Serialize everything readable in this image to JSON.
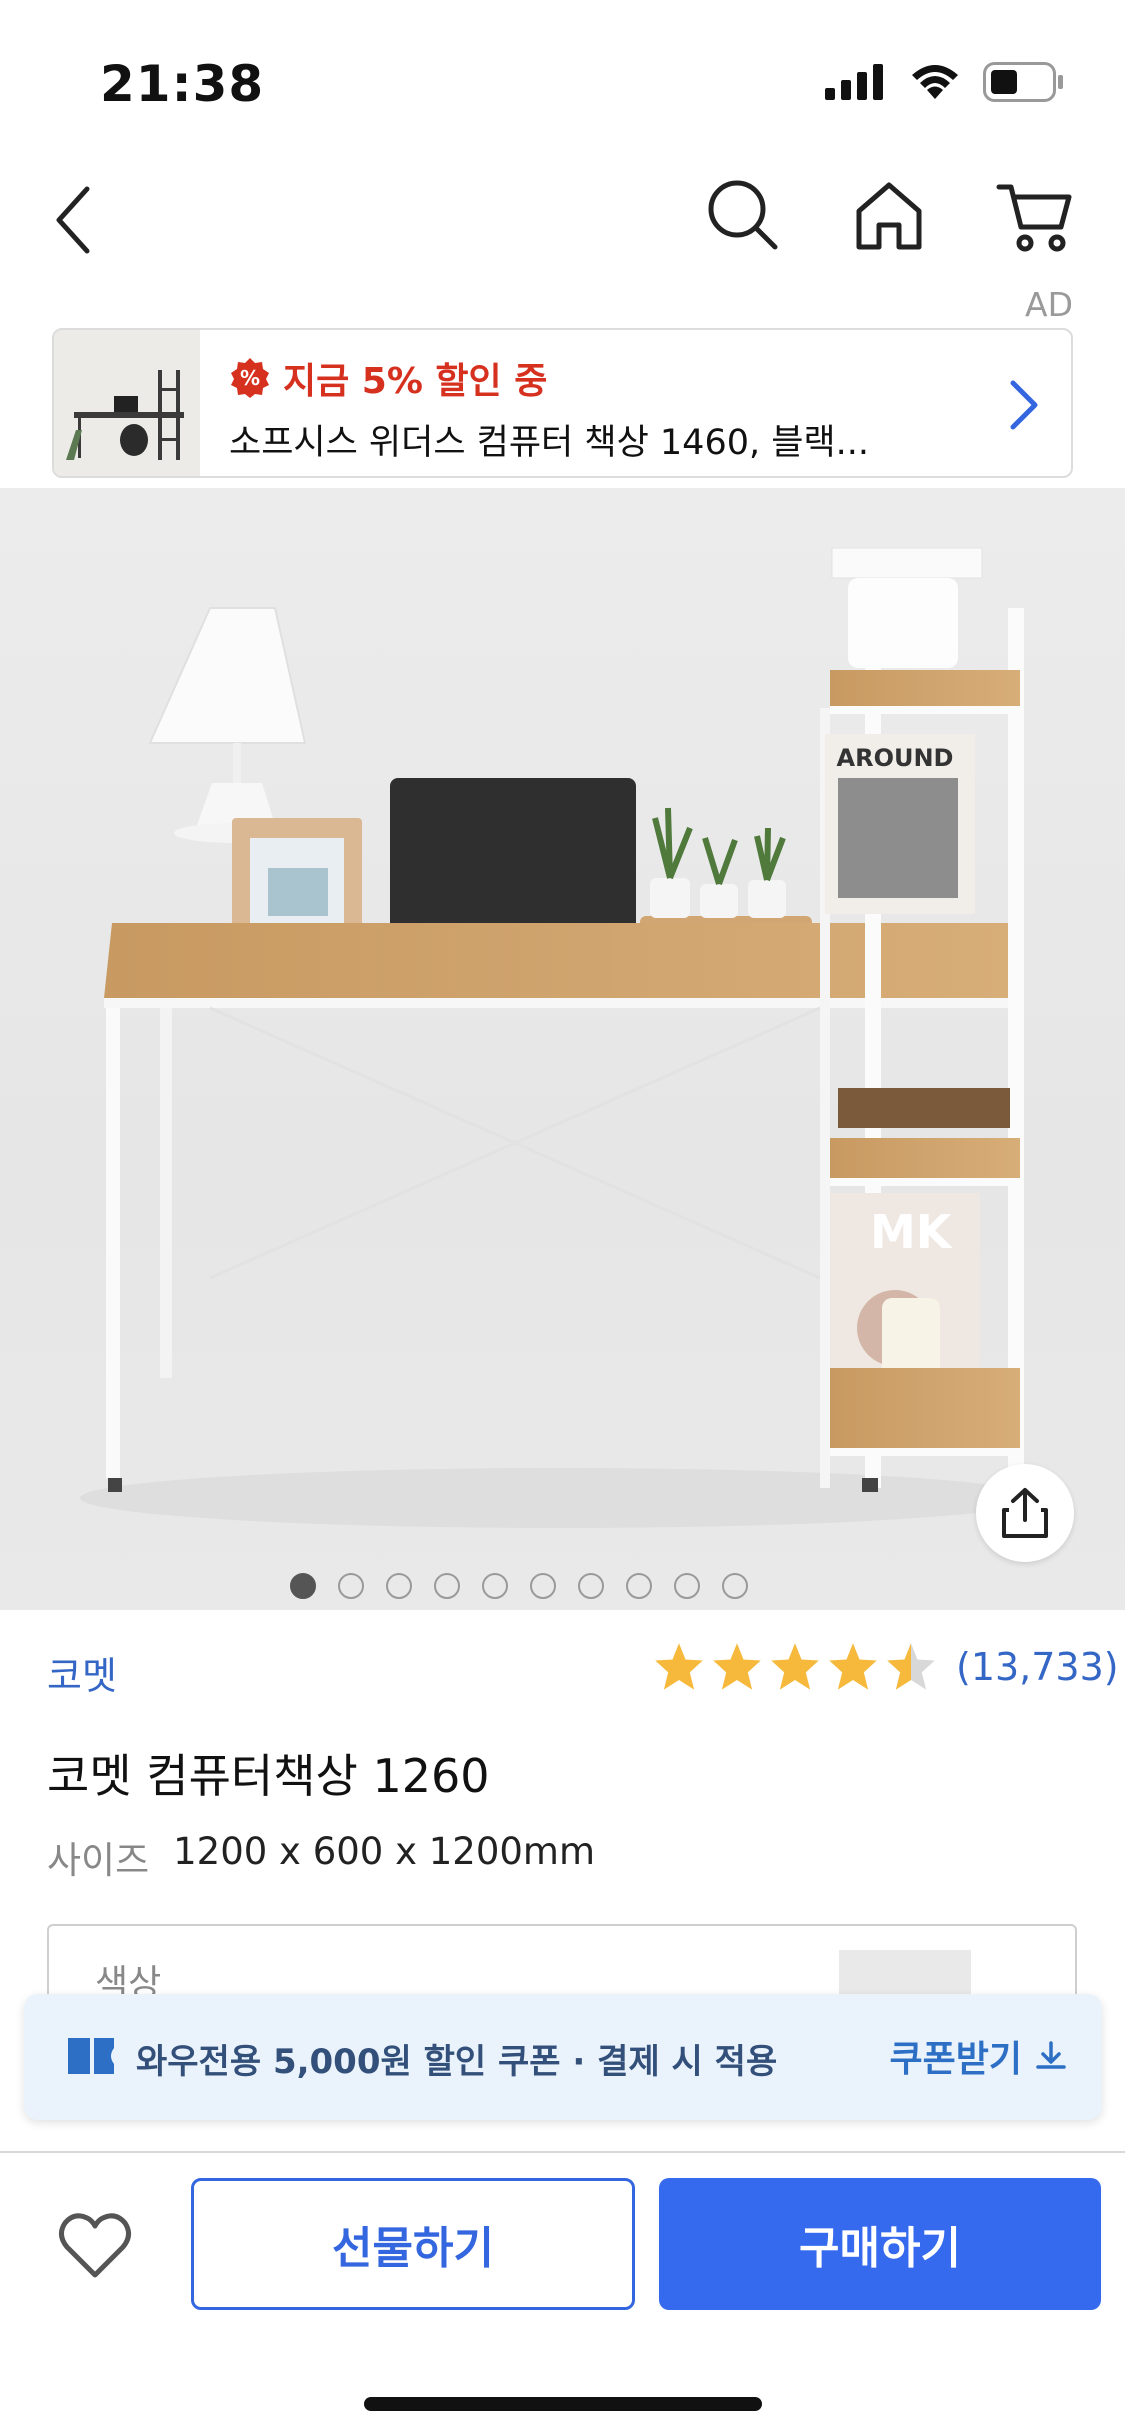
{
  "status_bar": {
    "time": "21:38"
  },
  "nav": {
    "back_icon": "chevron-left-icon",
    "icons": [
      "search-icon",
      "home-icon",
      "cart-icon"
    ]
  },
  "ad": {
    "tag": "AD",
    "badge_text": "지금 5% 할인 중",
    "title": "소프시스 위더스 컴퓨터 책상 1460, 블랙...",
    "badge_color": "#d6301f"
  },
  "gallery": {
    "image_count": 10,
    "active_index": 0,
    "share_icon": "share-icon"
  },
  "product": {
    "brand": "코멧",
    "rating_value": 4.5,
    "rating_count": "(13,733)",
    "name": "코멧 컴퓨터책상 1260",
    "spec_label": "사이즈",
    "spec_value": "1200 x 600 x 1200mm",
    "option_label": "색상"
  },
  "coupon": {
    "text": "와우전용 5,000원 할인 쿠폰 · 결제 시 적용",
    "button_label": "쿠폰받기"
  },
  "actions": {
    "gift_label": "선물하기",
    "buy_label": "구매하기"
  },
  "colors": {
    "accent": "#356aef",
    "link": "#3466c5",
    "star": "#f6b93b"
  }
}
